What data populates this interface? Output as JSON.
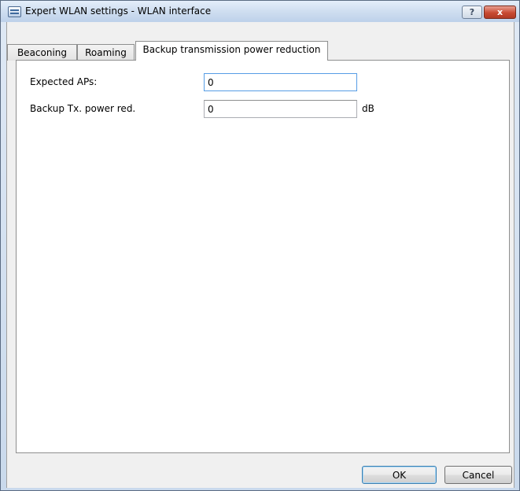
{
  "window": {
    "title": "Expert WLAN settings - WLAN interface",
    "help_label": "?",
    "close_label": "x"
  },
  "tabs": [
    {
      "label": "Beaconing",
      "active": false
    },
    {
      "label": "Roaming",
      "active": false
    },
    {
      "label": "Backup transmission power reduction",
      "active": true
    }
  ],
  "form": {
    "expected_aps": {
      "label": "Expected APs:",
      "value": "0"
    },
    "backup_tx_power": {
      "label": "Backup Tx. power red.",
      "value": "0",
      "unit": "dB"
    }
  },
  "buttons": {
    "ok_label": "OK",
    "cancel_label": "Cancel"
  }
}
